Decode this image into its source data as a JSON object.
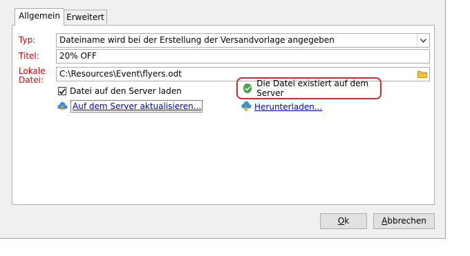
{
  "tabs": [
    {
      "label": "Allgemein",
      "active": true
    },
    {
      "label": "Erweitert",
      "active": false
    }
  ],
  "form": {
    "type_label": "Typ:",
    "type_value": "Dateiname wird bei der Erstellung der Versandvorlage angegeben",
    "title_label": "Titel:",
    "title_value": "20% OFF",
    "local_file_label_1": "Lokale",
    "local_file_label_2": "Datei:",
    "local_file_value": "C:\\Resources\\Event\\flyers.odt"
  },
  "upload_checkbox": {
    "label": "Datei auf den Server laden",
    "checked": true
  },
  "status": {
    "text": "Die Datei existiert auf dem Server",
    "color": "#3ea84a",
    "highlight": "#d0262c"
  },
  "links": {
    "update": "Auf dem Server aktualisieren...",
    "download": "Herunterladen..."
  },
  "buttons": {
    "ok_mnemonic": "O",
    "ok_rest": "k",
    "cancel_mnemonic": "A",
    "cancel_rest": "bbrechen"
  },
  "icons": {
    "update": "cloud-upload-icon",
    "download": "cloud-download-icon",
    "folder": "folder-icon",
    "status": "check-circle-icon"
  }
}
